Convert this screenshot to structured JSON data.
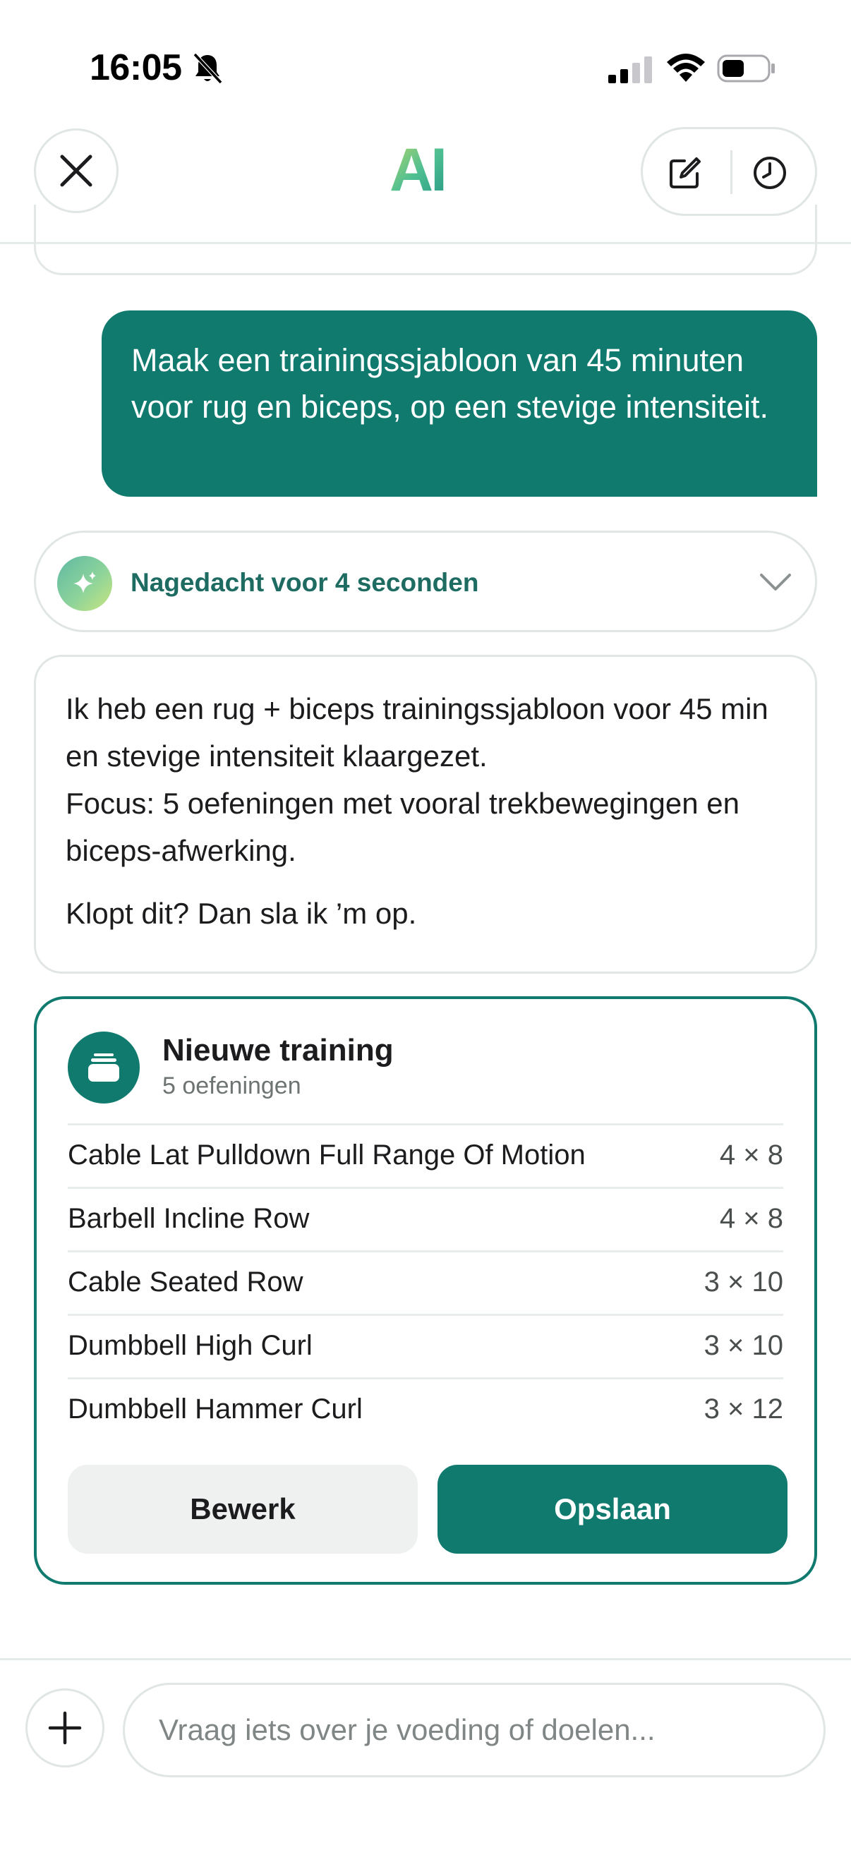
{
  "status_bar": {
    "time": "16:05",
    "icons": [
      "bell-slash-icon",
      "signal-icon",
      "wifi-icon",
      "battery-icon"
    ]
  },
  "header": {
    "logo_text": "AI",
    "close_icon": "close-icon",
    "actions": [
      "compose-icon",
      "history-clock-icon"
    ]
  },
  "conversation": {
    "user_message": "Maak een trainingssjabloon van 45 minuten voor rug en biceps, op een stevige intensiteit.",
    "thinking": {
      "label": "Nagedacht voor 4 seconden",
      "icon": "sparkle-icon"
    },
    "assistant_message": {
      "paragraph_1_line_1": "Ik heb een rug + biceps trainingssjabloon voor 45 min en stevige intensiteit klaargezet.",
      "paragraph_1_line_2": "Focus: 5 oefeningen met vooral trekbewegingen en biceps-afwerking.",
      "paragraph_2": "Klopt dit? Dan sla ik ’m op."
    }
  },
  "workout_card": {
    "title": "Nieuwe training",
    "subtitle": "5 oefeningen",
    "icon": "workout-stack-icon",
    "exercises": [
      {
        "name": "Cable Lat Pulldown Full Range Of Motion",
        "sets": "4 × 8"
      },
      {
        "name": "Barbell Incline Row",
        "sets": "4 × 8"
      },
      {
        "name": "Cable Seated Row",
        "sets": "3 × 10"
      },
      {
        "name": "Dumbbell High Curl",
        "sets": "3 × 10"
      },
      {
        "name": "Dumbbell Hammer Curl",
        "sets": "3 × 12"
      }
    ],
    "edit_label": "Bewerk",
    "save_label": "Opslaan"
  },
  "composer": {
    "placeholder": "Vraag iets over je voeding of doelen...",
    "value": "",
    "add_icon": "plus-icon"
  },
  "colors": {
    "accent": "#0f7a6d",
    "thinking_text": "#1d6b61",
    "border": "#e0e6e4",
    "muted_text": "#6d7472",
    "secondary_button": "#eff0f0"
  }
}
